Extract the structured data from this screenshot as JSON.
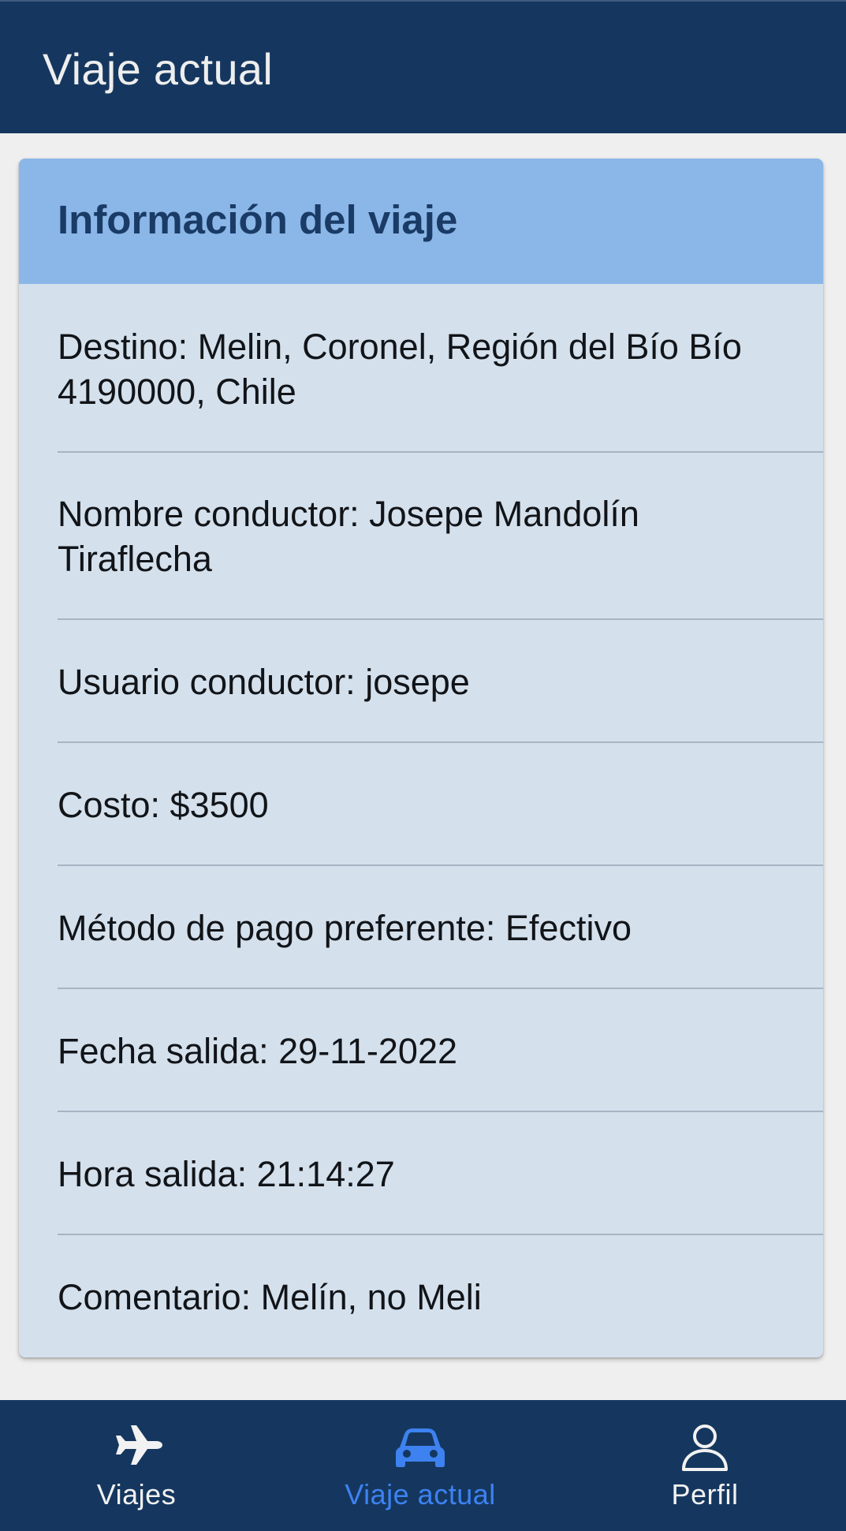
{
  "header": {
    "title": "Viaje actual"
  },
  "card": {
    "title": "Información del viaje",
    "items": [
      "Destino: Melin, Coronel, Región del Bío Bío 4190000, Chile",
      "Nombre conductor: Josepe Mandolín Tiraflecha",
      "Usuario conductor: josepe",
      "Costo: $3500",
      "Método de pago preferente: Efectivo",
      "Fecha salida: 29-11-2022",
      "Hora salida: 21:14:27",
      "Comentario: Melín, no Meli"
    ]
  },
  "bottom_nav": {
    "items": [
      {
        "label": "Viajes",
        "icon": "airplane-icon",
        "active": false
      },
      {
        "label": "Viaje actual",
        "icon": "car-icon",
        "active": true
      },
      {
        "label": "Perfil",
        "icon": "person-icon",
        "active": false
      }
    ]
  },
  "colors": {
    "header_bg": "#15375f",
    "card_header_bg": "#8bb7e8",
    "card_body_bg": "#d4e0ec",
    "active_nav": "#3d82f0"
  }
}
